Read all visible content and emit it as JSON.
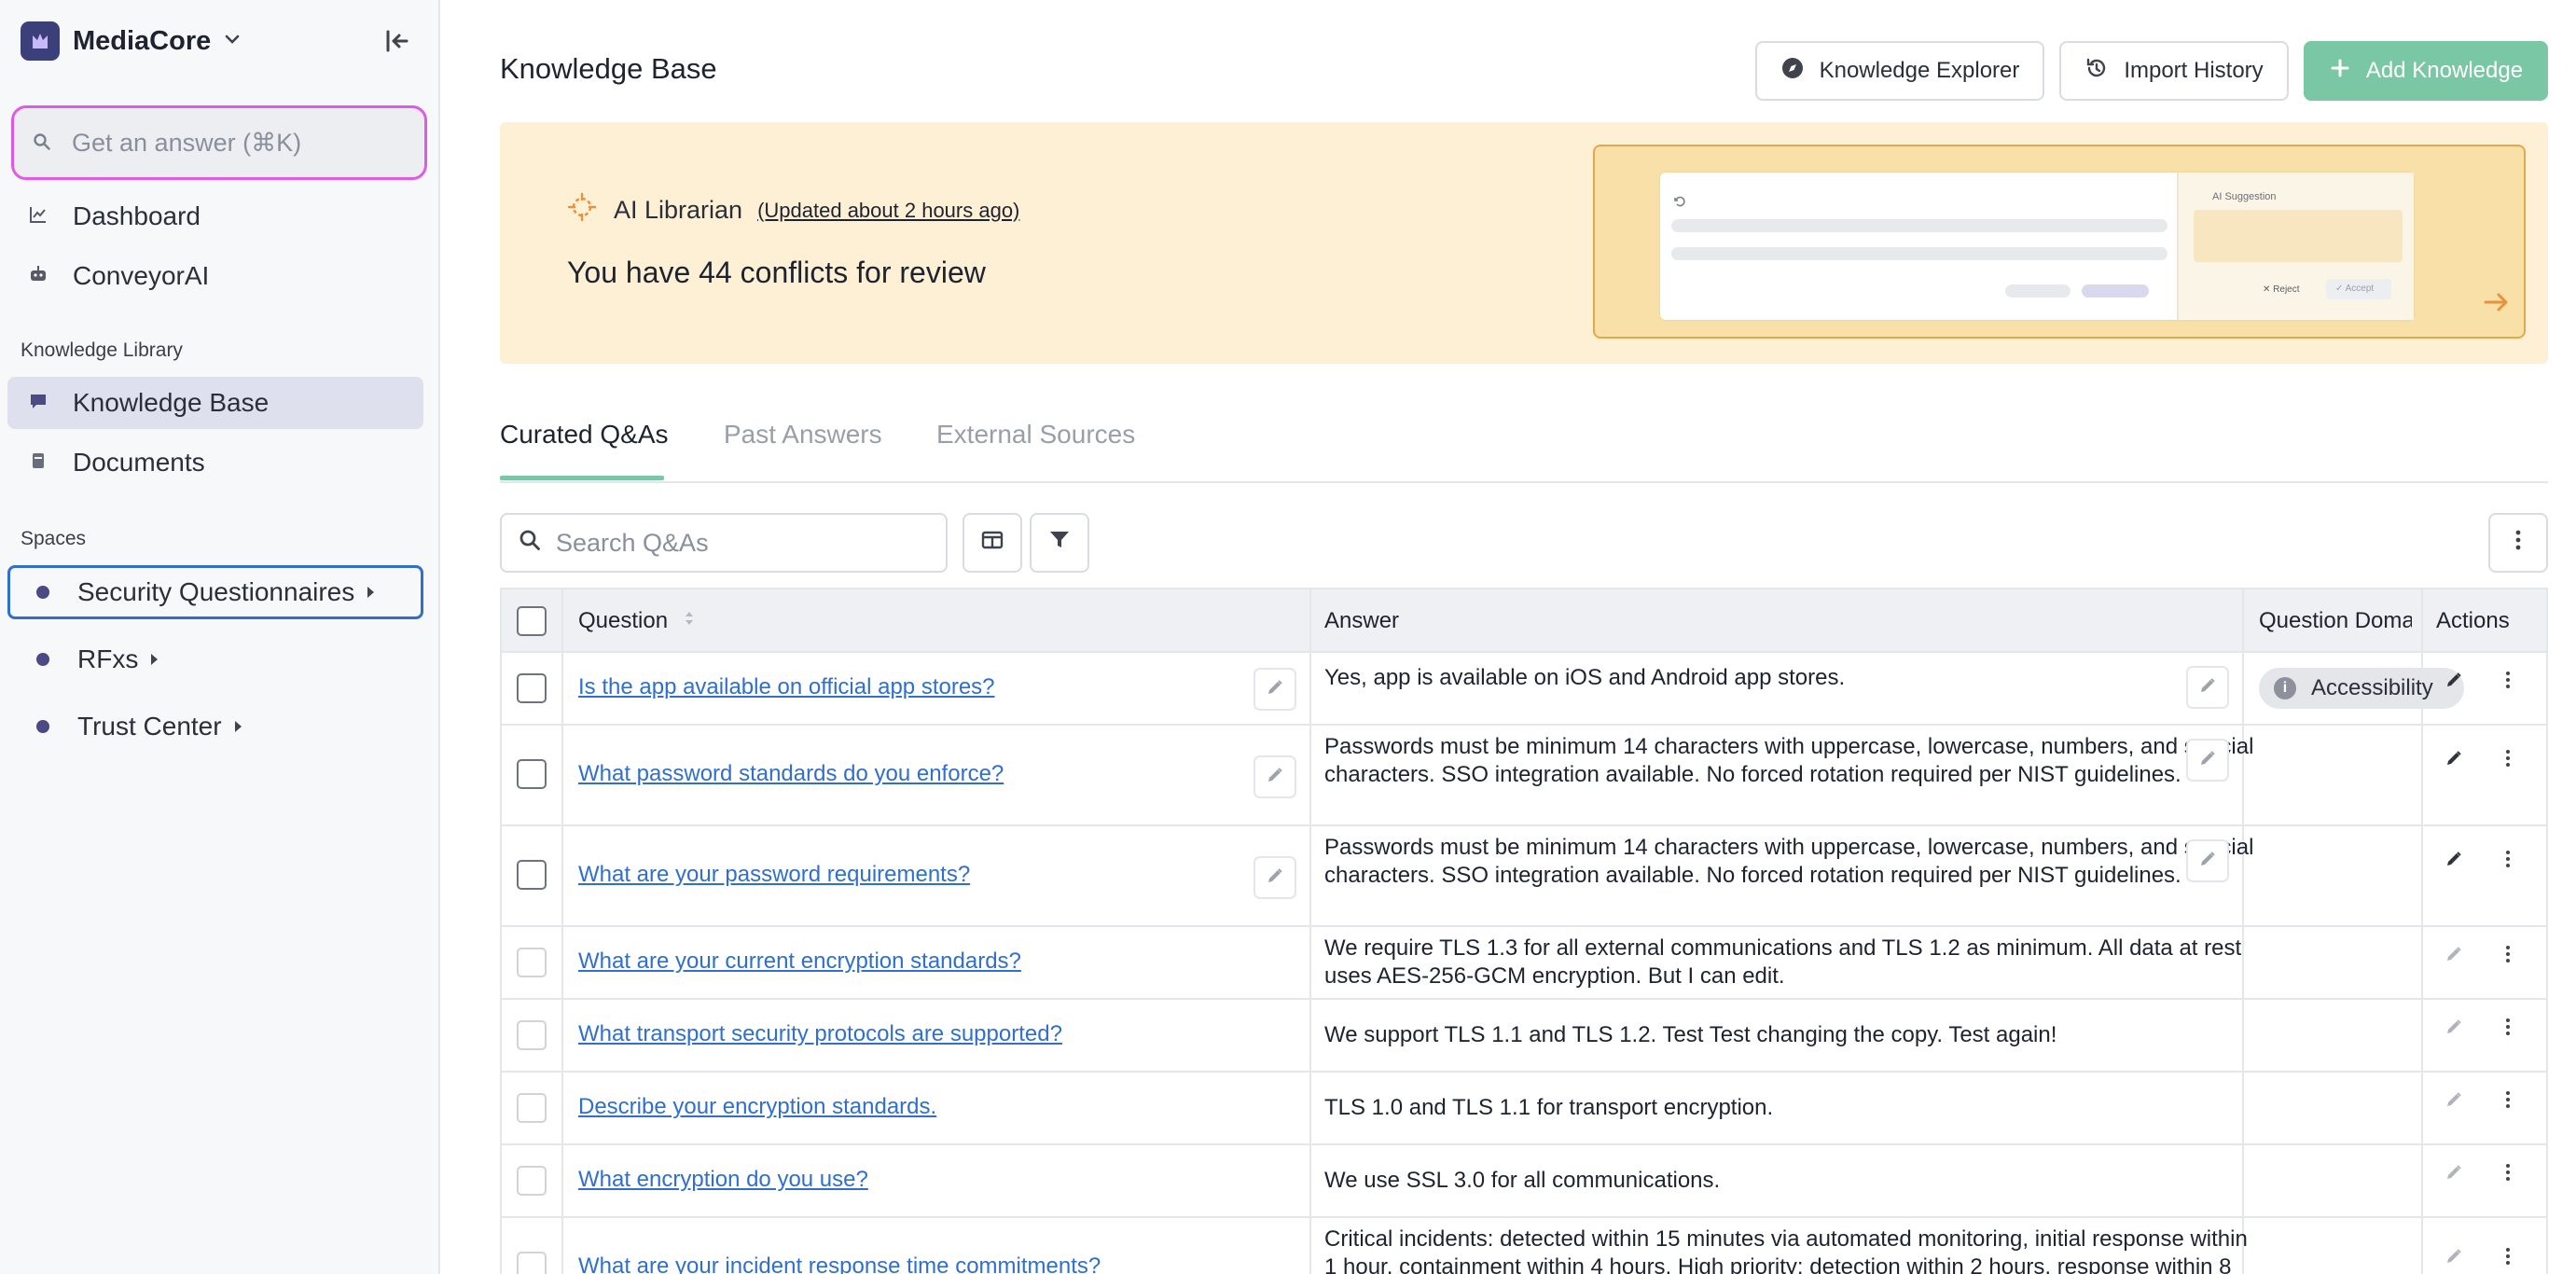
{
  "app": {
    "name": "MediaCore"
  },
  "sidebar": {
    "ask_placeholder": "Get an answer (⌘K)",
    "top_items": [
      {
        "label": "Dashboard",
        "icon": "chart-icon"
      },
      {
        "label": "ConveyorAI",
        "icon": "robot-icon"
      }
    ],
    "library_label": "Knowledge Library",
    "library_items": [
      {
        "label": "Knowledge Base",
        "icon": "chat-bubble-icon",
        "active": true
      },
      {
        "label": "Documents",
        "icon": "document-icon"
      }
    ],
    "spaces_label": "Spaces",
    "spaces": [
      {
        "label": "Security Questionnaires",
        "focused": true
      },
      {
        "label": "RFxs"
      },
      {
        "label": "Trust Center"
      }
    ]
  },
  "header": {
    "title": "Knowledge Base",
    "explorer_label": "Knowledge Explorer",
    "history_label": "Import History",
    "add_label": "Add Knowledge"
  },
  "banner": {
    "name": "AI Librarian",
    "updated": "(Updated about 2 hours ago)",
    "message": "You have 44 conflicts for review",
    "preview": {
      "suggestion_title": "AI Suggestion",
      "reject_label": "✕ Reject",
      "accept_label": "✓ Accept"
    }
  },
  "tabs": [
    "Curated Q&As",
    "Past Answers",
    "External Sources"
  ],
  "toolbar": {
    "search_placeholder": "Search Q&As"
  },
  "table": {
    "columns": {
      "question": "Question",
      "answer": "Answer",
      "domain": "Question Domain",
      "actions": "Actions"
    },
    "rows": [
      {
        "question": "Is the app available on official app stores?",
        "answer": "Yes, app is available on iOS and Android app stores.",
        "domain": "Accessibility"
      },
      {
        "question": "What password standards do you enforce?",
        "answer": "Passwords must be minimum 14 characters with uppercase, lowercase, numbers, and special characters. SSO integration available. No forced rotation required per NIST guidelines.",
        "domain": ""
      },
      {
        "question": "What are your password requirements?",
        "answer": "Passwords must be minimum 14 characters with uppercase, lowercase, numbers, and special characters. SSO integration available. No forced rotation required per NIST guidelines.",
        "domain": ""
      },
      {
        "question": "What are your current encryption standards?",
        "answer": "We require TLS 1.3 for all external communications and TLS 1.2 as minimum. All data at rest uses AES-256-GCM encryption. But I can edit.",
        "domain": ""
      },
      {
        "question": "What transport security protocols are supported?",
        "answer": "We support TLS 1.1 and TLS 1.2. Test Test changing the copy. Test again!",
        "domain": ""
      },
      {
        "question": "Describe your encryption standards.",
        "answer": "TLS 1.0 and TLS 1.1 for transport encryption.",
        "domain": ""
      },
      {
        "question": "What encryption do you use?",
        "answer": "We use SSL 3.0 for all communications.",
        "domain": ""
      },
      {
        "question": "What are your incident response time commitments?",
        "answer": "Critical incidents: detected within 15 minutes via automated monitoring, initial response within 1 hour, containment within 4 hours. High priority: detection within 2 hours, response within 8",
        "domain": ""
      }
    ]
  },
  "colors": {
    "accent_green": "#79c7a5",
    "link_blue": "#2f6fd0",
    "banner_bg": "#fdf0d4",
    "focus_pink": "#e15ae6",
    "brand_purple": "#3b3f7a"
  }
}
